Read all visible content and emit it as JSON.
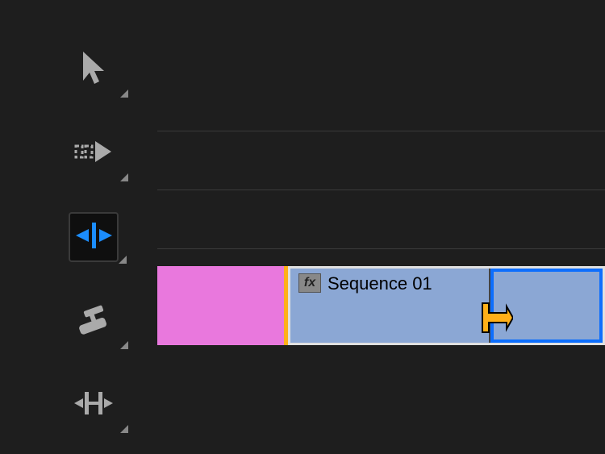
{
  "toolbar": {
    "tools": [
      {
        "name": "selection",
        "icon": "selection-tool-icon"
      },
      {
        "name": "track-select-forward",
        "icon": "track-select-forward-icon"
      },
      {
        "name": "ripple-edit",
        "icon": "ripple-edit-icon",
        "selected": true
      },
      {
        "name": "razor",
        "icon": "razor-icon"
      },
      {
        "name": "slip",
        "icon": "slip-icon"
      }
    ]
  },
  "timeline": {
    "clips": [
      {
        "name": "clip-pink",
        "color": "#e978dd"
      },
      {
        "name": "clip-sequence",
        "color": "#8ba7d4",
        "fx_label": "fx",
        "label": "Sequence 01"
      }
    ]
  },
  "colors": {
    "background": "#1e1e1e",
    "accent_blue": "#1b8dff",
    "clip_pink": "#e978dd",
    "clip_blue": "#8ba7d4",
    "marker_orange": "#ffb019",
    "selection_blue": "#0d6efd"
  }
}
